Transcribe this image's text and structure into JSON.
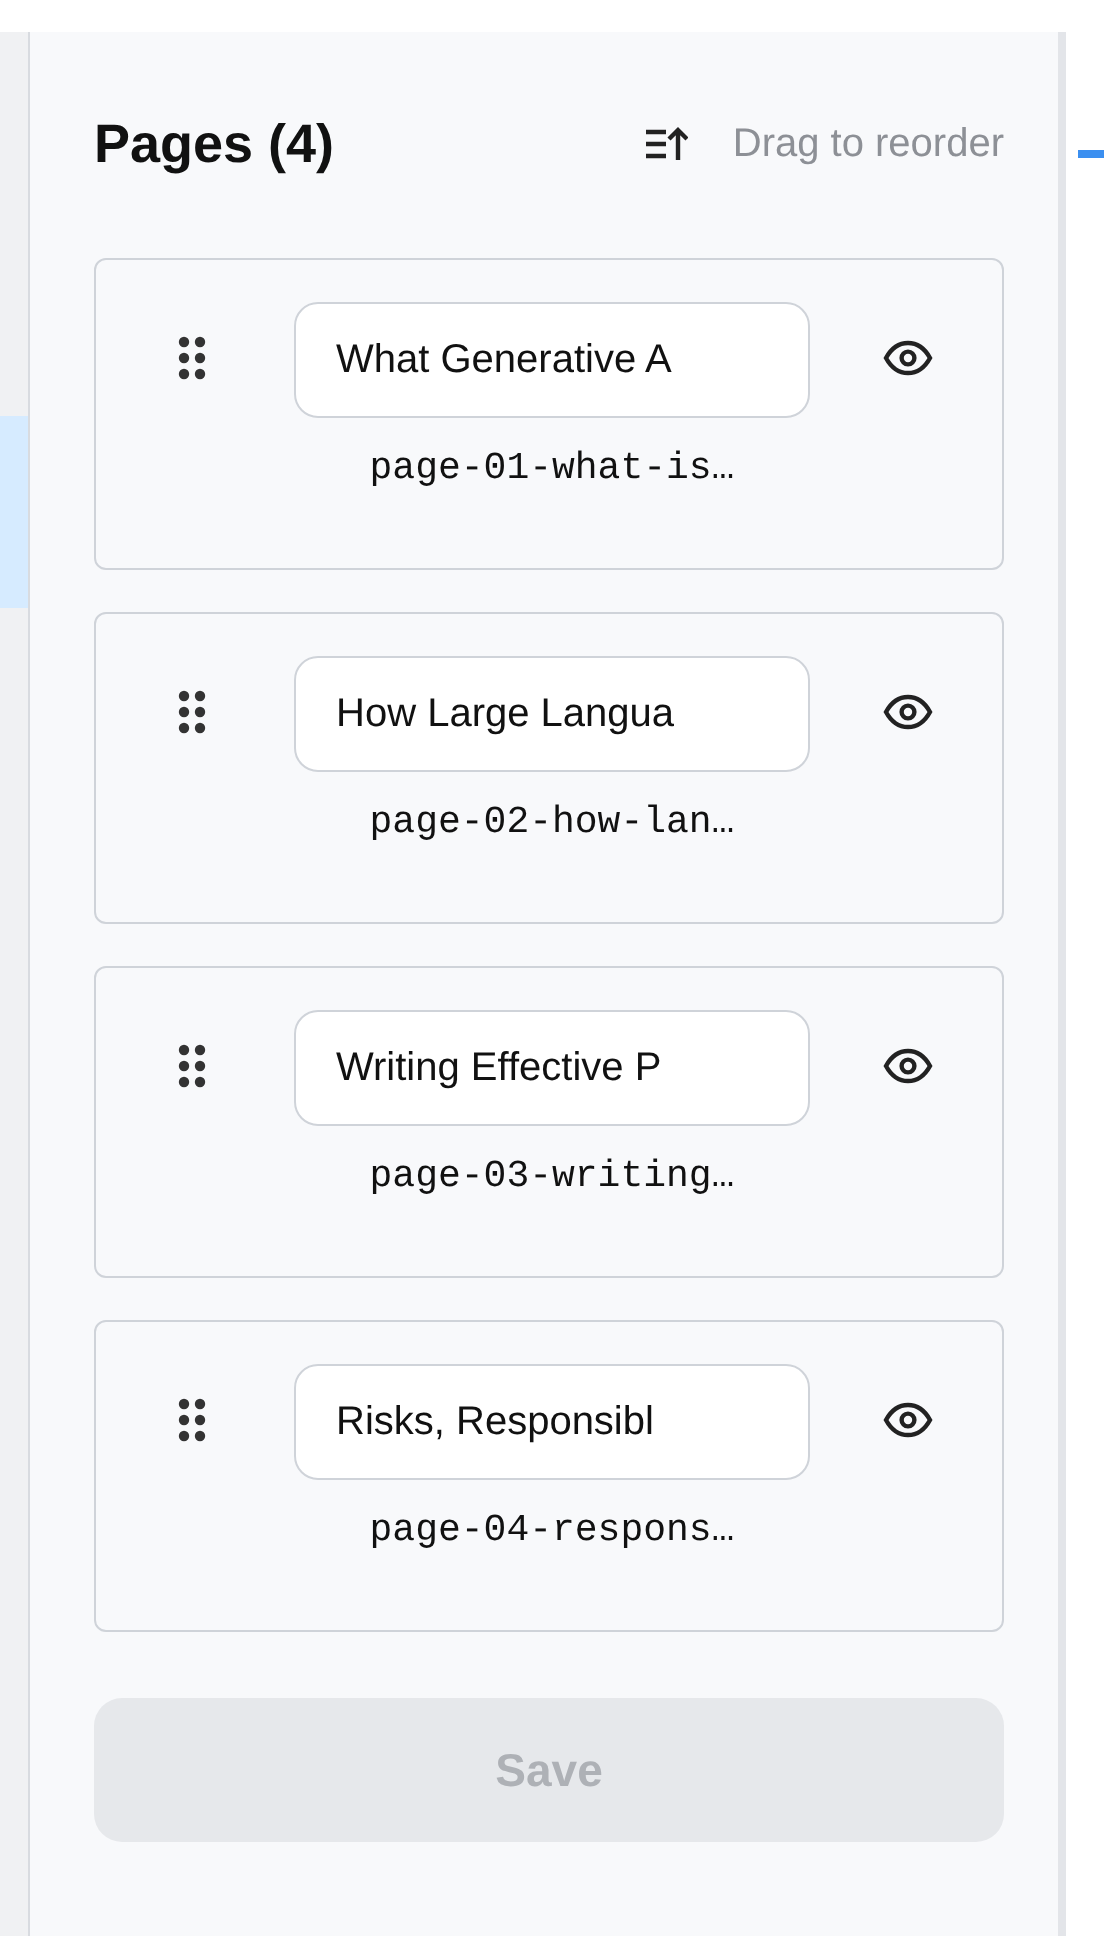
{
  "header": {
    "title": "Pages (4)",
    "hint": "Drag to reorder"
  },
  "pages": [
    {
      "title": "What Generative A",
      "slug": "page-01-what-is…",
      "visible": true
    },
    {
      "title": "How Large Langua",
      "slug": "page-02-how-lan…",
      "visible": true
    },
    {
      "title": "Writing Effective P",
      "slug": "page-03-writing…",
      "visible": true
    },
    {
      "title": "Risks, Responsibl",
      "slug": "page-04-respons…",
      "visible": true
    }
  ],
  "save_button": {
    "label": "Save",
    "disabled": true
  }
}
